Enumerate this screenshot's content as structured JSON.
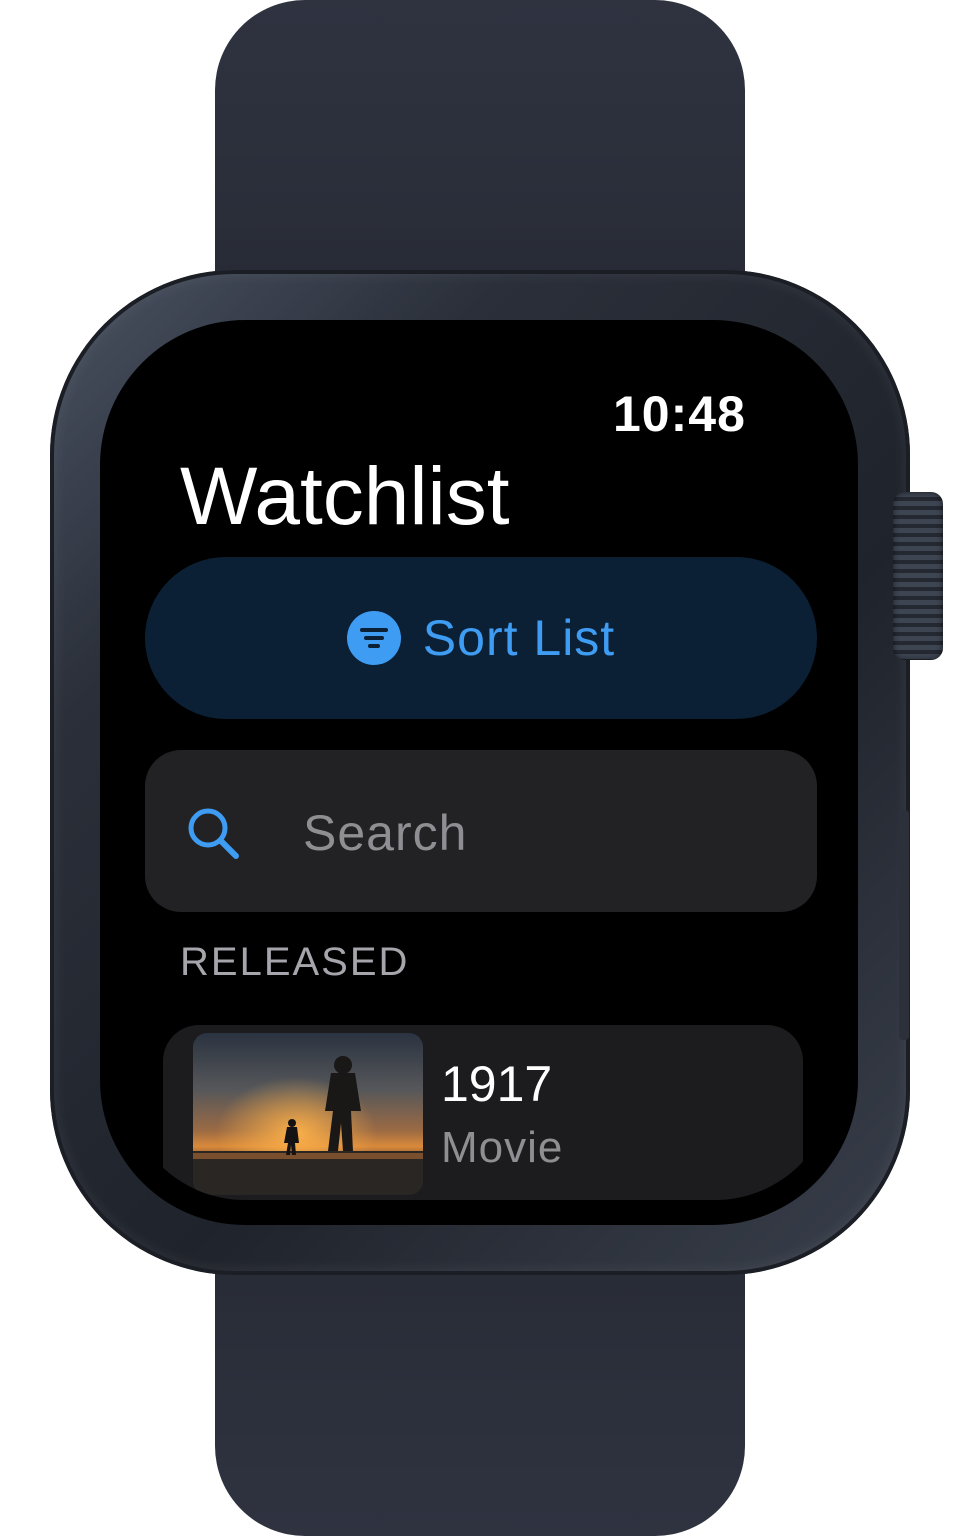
{
  "status_bar": {
    "time": "10:48"
  },
  "header": {
    "title": "Watchlist"
  },
  "sort_button": {
    "label": "Sort List",
    "icon": "sort-filter-icon"
  },
  "search": {
    "placeholder": "Search",
    "icon": "search-icon"
  },
  "sections": [
    {
      "header": "RELEASED",
      "items": [
        {
          "title": "1917",
          "subtitle": "Movie",
          "thumbnail": "movie-poster-soldier-sunset"
        }
      ]
    }
  ],
  "colors": {
    "accent": "#3e9cf3",
    "button_bg": "#0b2035",
    "field_bg": "#222225",
    "row_bg": "#1c1c1e",
    "secondary_text": "#8e8e93"
  }
}
